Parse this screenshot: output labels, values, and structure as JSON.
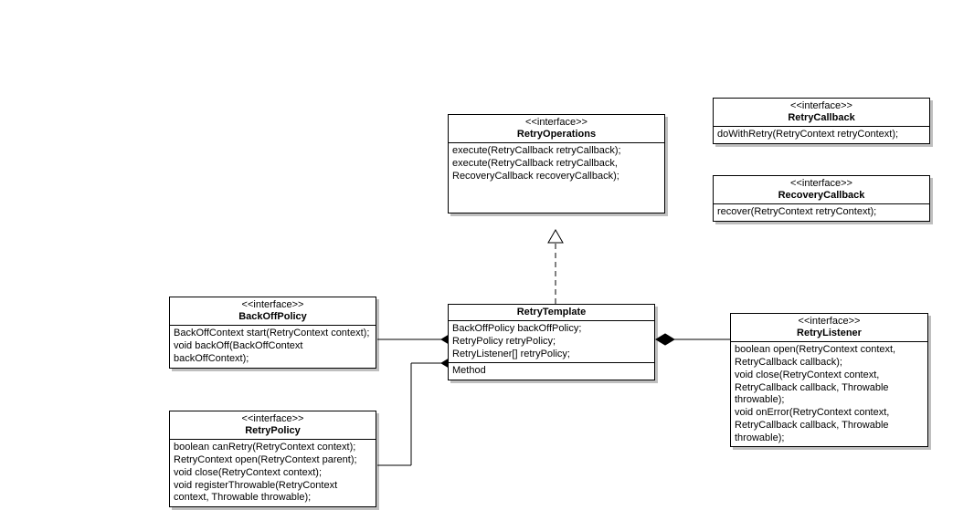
{
  "stereotype": "<<interface>>",
  "retryOperations": {
    "name": "RetryOperations",
    "ops": [
      "execute(RetryCallback retryCallback);",
      "execute(RetryCallback retryCallback,",
      "RecoveryCallback recoveryCallback);"
    ]
  },
  "retryCallback": {
    "name": "RetryCallback",
    "ops": [
      "doWithRetry(RetryContext retryContext);"
    ]
  },
  "recoveryCallback": {
    "name": "RecoveryCallback",
    "ops": [
      "recover(RetryContext retryContext);"
    ]
  },
  "backOffPolicy": {
    "name": "BackOffPolicy",
    "ops": [
      "BackOffContext start(RetryContext context);",
      "void backOff(BackOffContext",
      "backOffContext);"
    ]
  },
  "retryTemplate": {
    "name": "RetryTemplate",
    "attrs": [
      "BackOffPolicy backOffPolicy;",
      "RetryPolicy retryPolicy;",
      "RetryListener[] retryPolicy;"
    ],
    "method": "Method"
  },
  "retryListener": {
    "name": "RetryListener",
    "ops": [
      "boolean open(RetryContext context,",
      "RetryCallback callback);",
      "void close(RetryContext context,",
      "RetryCallback callback, Throwable",
      "throwable);",
      "void onError(RetryContext context,",
      "RetryCallback callback, Throwable",
      "throwable);"
    ]
  },
  "retryPolicy": {
    "name": "RetryPolicy",
    "ops": [
      "boolean canRetry(RetryContext context);",
      "RetryContext open(RetryContext parent);",
      "void close(RetryContext context);",
      "void registerThrowable(RetryContext",
      "context, Throwable throwable);"
    ]
  },
  "chart_data": {
    "type": "uml_class_diagram",
    "classes": [
      {
        "name": "RetryOperations",
        "stereotype": "interface",
        "operations": [
          "execute(RetryCallback retryCallback);",
          "execute(RetryCallback retryCallback, RecoveryCallback recoveryCallback);"
        ]
      },
      {
        "name": "RetryCallback",
        "stereotype": "interface",
        "operations": [
          "doWithRetry(RetryContext retryContext);"
        ]
      },
      {
        "name": "RecoveryCallback",
        "stereotype": "interface",
        "operations": [
          "recover(RetryContext retryContext);"
        ]
      },
      {
        "name": "BackOffPolicy",
        "stereotype": "interface",
        "operations": [
          "BackOffContext start(RetryContext context);",
          "void backOff(BackOffContext backOffContext);"
        ]
      },
      {
        "name": "RetryTemplate",
        "attributes": [
          "BackOffPolicy backOffPolicy;",
          "RetryPolicy retryPolicy;",
          "RetryListener[] retryPolicy;"
        ],
        "operations": [
          "Method"
        ]
      },
      {
        "name": "RetryListener",
        "stereotype": "interface",
        "operations": [
          "boolean open(RetryContext context, RetryCallback callback);",
          "void close(RetryContext context, RetryCallback callback, Throwable throwable);",
          "void onError(RetryContext context, RetryCallback callback, Throwable throwable);"
        ]
      },
      {
        "name": "RetryPolicy",
        "stereotype": "interface",
        "operations": [
          "boolean canRetry(RetryContext context);",
          "RetryContext open(RetryContext parent);",
          "void close(RetryContext context);",
          "void registerThrowable(RetryContext context, Throwable throwable);"
        ]
      }
    ],
    "relationships": [
      {
        "from": "RetryTemplate",
        "to": "RetryOperations",
        "type": "realization"
      },
      {
        "from": "RetryTemplate",
        "to": "BackOffPolicy",
        "type": "composition"
      },
      {
        "from": "RetryTemplate",
        "to": "RetryPolicy",
        "type": "composition"
      },
      {
        "from": "RetryTemplate",
        "to": "RetryListener",
        "type": "composition"
      }
    ]
  }
}
